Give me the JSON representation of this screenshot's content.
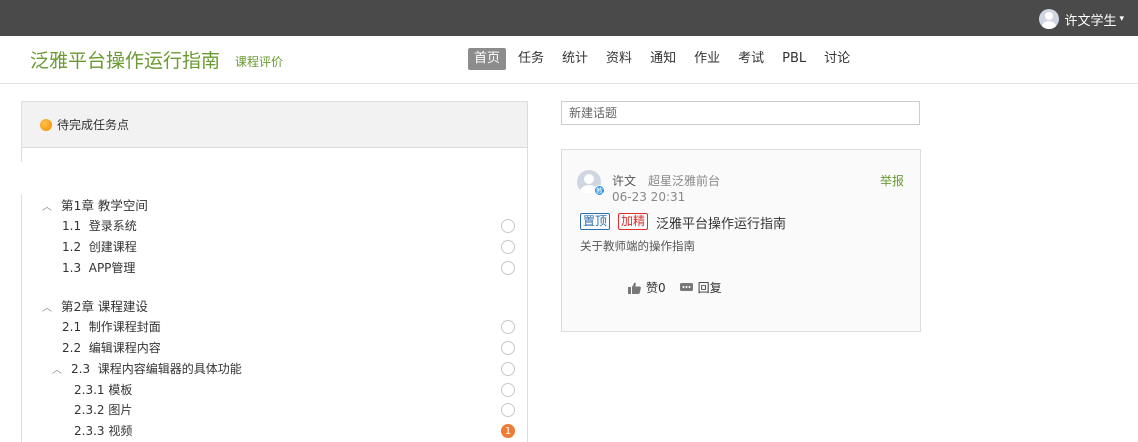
{
  "topbar": {
    "user_name": "许文学生"
  },
  "header": {
    "course_title": "泛雅平台操作运行指南",
    "course_eval": "课程评价",
    "nav": [
      "首页",
      "任务",
      "统计",
      "资料",
      "通知",
      "作业",
      "考试",
      "PBL",
      "讨论"
    ],
    "active_nav": "首页"
  },
  "tasks": {
    "title": "待完成任务点",
    "chapters": [
      {
        "label": "第1章 教学空间",
        "items": [
          {
            "num": "1.1",
            "label": "登录系统"
          },
          {
            "num": "1.2",
            "label": "创建课程"
          },
          {
            "num": "1.3",
            "label": "APP管理"
          }
        ]
      },
      {
        "label": "第2章 课程建设",
        "items": [
          {
            "num": "2.1",
            "label": "制作课程封面"
          },
          {
            "num": "2.2",
            "label": "编辑课程内容"
          },
          {
            "num": "2.3",
            "label": "课程内容编辑器的具体功能"
          },
          {
            "num": "2.3.1",
            "label": "模板"
          },
          {
            "num": "2.3.2",
            "label": "图片"
          },
          {
            "num": "2.3.3",
            "label": "视频",
            "badge": "1"
          }
        ]
      }
    ]
  },
  "discussion": {
    "new_topic_placeholder": "新建话题",
    "post": {
      "author": "许文",
      "source": "超星泛雅前台",
      "time": "06-23 20:31",
      "report": "举报",
      "teacher_badge": "教",
      "tag_top": "置顶",
      "tag_best": "加精",
      "title": "泛雅平台操作运行指南",
      "desc": "关于教师端的操作指南",
      "like_label": "赞0",
      "reply_label": "回复"
    }
  }
}
